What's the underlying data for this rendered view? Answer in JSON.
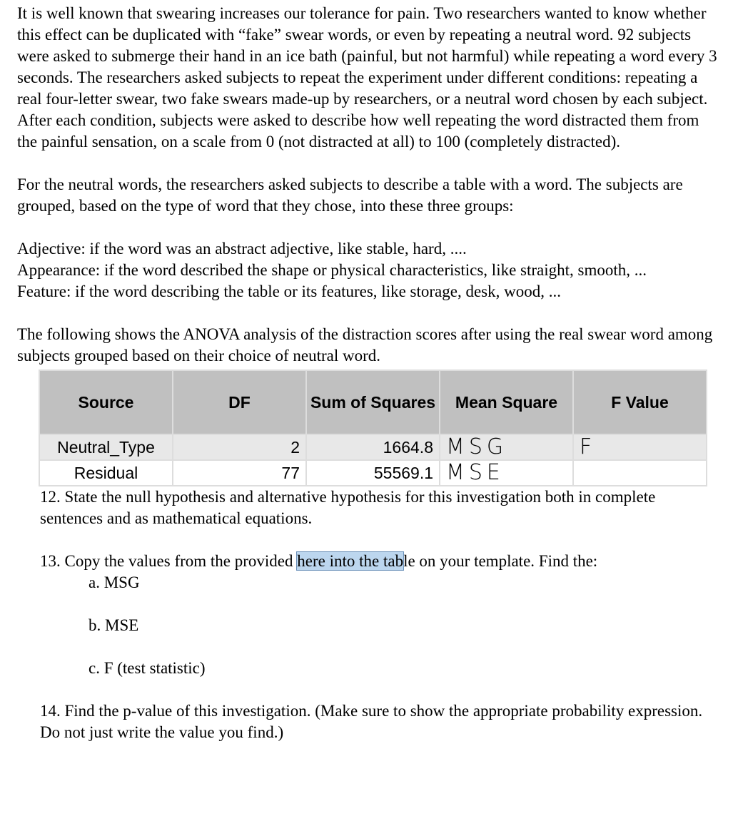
{
  "intro": "It is well known that swearing increases our tolerance for pain. Two researchers wanted to know whether this effect can be duplicated with “fake” swear words, or even by repeating a neutral word. 92 subjects were asked to submerge their hand in an ice bath (painful, but not harmful) while repeating a word every 3 seconds. The researchers asked subjects to repeat the experiment under different conditions: repeating a real four-letter swear, two fake swears made-up by researchers, or a neutral word chosen by each subject. After each condition, subjects were asked to describe how well repeating the word distracted them from the painful sensation, on a scale from 0 (not distracted at all) to 100 (completely distracted).",
  "neutral": "For the neutral words, the researchers asked subjects to describe a table with a word. The subjects are grouped, based on the type of word that they chose, into these three groups:",
  "groups": [
    "Adjective: if the word was an abstract adjective, like stable, hard, ....",
    "Appearance: if the word described the shape or physical characteristics, like straight, smooth, ...",
    "Feature: if the word describing the table or its features, like storage, desk, wood, ..."
  ],
  "anova_intro": "The following shows the ANOVA analysis of the distraction scores after using the real swear word among subjects grouped based on their choice of neutral word.",
  "table": {
    "headers": [
      "Source",
      "DF",
      "Sum of Squares",
      "Mean Square",
      "F Value"
    ],
    "rows": [
      [
        "Neutral_Type",
        "2",
        "1664.8",
        "MSG",
        "F"
      ],
      [
        "Residual",
        "77",
        "55569.1",
        "MSE",
        ""
      ]
    ]
  },
  "q12": "12. State the null hypothesis and alternative hypothesis for this investigation both in complete sentences and as mathematical equations.",
  "q13_pre": "13. Copy the values from the provided ",
  "q13_hl": "here into the tab",
  "q13_post": "le on your template.  Find the:",
  "q13_items": [
    "a.  MSG",
    "b.  MSE",
    "c.  F (test statistic)"
  ],
  "q14": "14. Find the p-value of this investigation.  (Make sure to show the appropriate probability expression.  Do not just write the value you find.)"
}
